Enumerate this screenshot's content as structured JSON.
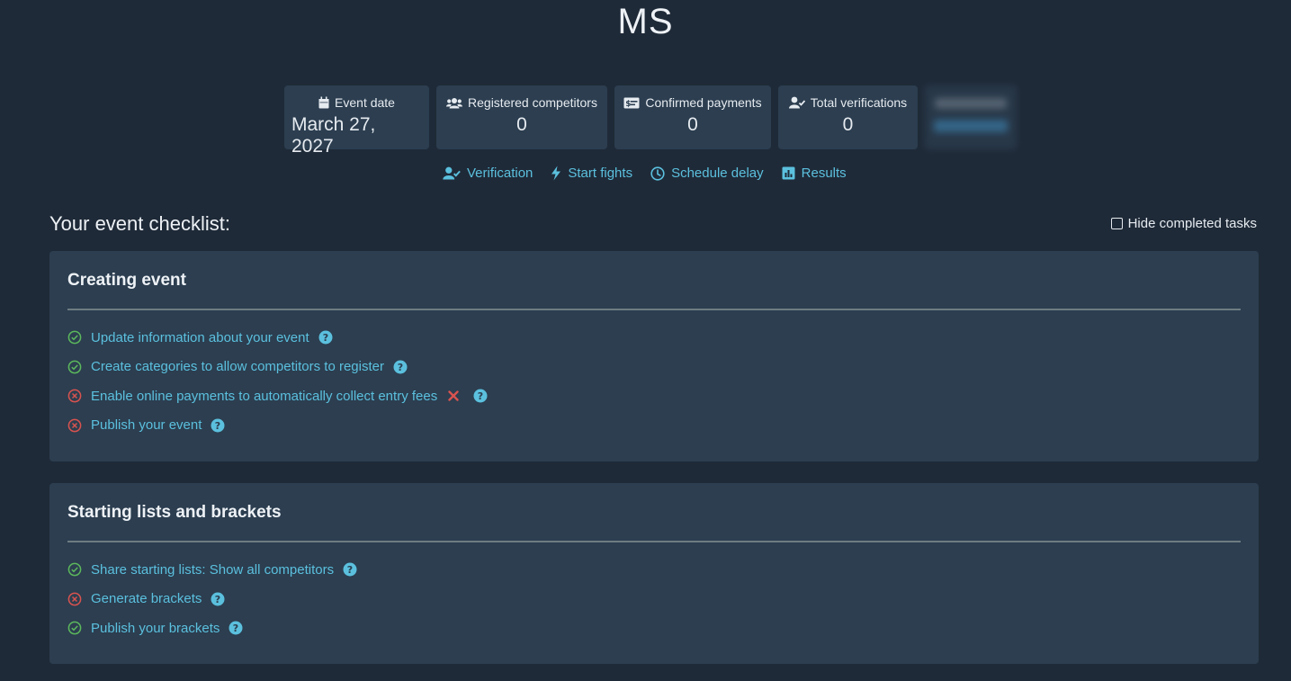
{
  "header": {
    "title": "MS"
  },
  "stats": [
    {
      "icon": "calendar-icon",
      "label": "Event date",
      "value": "March 27, 2027"
    },
    {
      "icon": "users-icon",
      "label": "Registered competitors",
      "value": "0"
    },
    {
      "icon": "money-check-icon",
      "label": "Confirmed payments",
      "value": "0"
    },
    {
      "icon": "user-check-icon",
      "label": "Total verifications",
      "value": "0"
    }
  ],
  "actions": [
    {
      "icon": "user-check-icon",
      "label": "Verification"
    },
    {
      "icon": "bolt-icon",
      "label": "Start fights"
    },
    {
      "icon": "clock-icon",
      "label": "Schedule delay"
    },
    {
      "icon": "chart-icon",
      "label": "Results"
    }
  ],
  "checklist": {
    "heading": "Your event checklist:",
    "hide_completed_label": "Hide completed tasks",
    "sections": [
      {
        "title": "Creating event",
        "tasks": [
          {
            "label": "Update information about your event",
            "status": "done"
          },
          {
            "label": "Create categories to allow competitors to register",
            "status": "done"
          },
          {
            "label": "Enable online payments to automatically collect entry fees",
            "status": "failed",
            "has_x": true
          },
          {
            "label": "Publish your event",
            "status": "failed"
          }
        ]
      },
      {
        "title": "Starting lists and brackets",
        "tasks": [
          {
            "label": "Share starting lists: Show all competitors",
            "status": "done"
          },
          {
            "label": "Generate brackets",
            "status": "failed"
          },
          {
            "label": "Publish your brackets",
            "status": "done"
          }
        ]
      }
    ]
  },
  "colors": {
    "background": "#1f2a38",
    "panel": "#2c3e50",
    "link": "#5bc0de",
    "success": "#5cb85c",
    "danger": "#d9534f"
  }
}
